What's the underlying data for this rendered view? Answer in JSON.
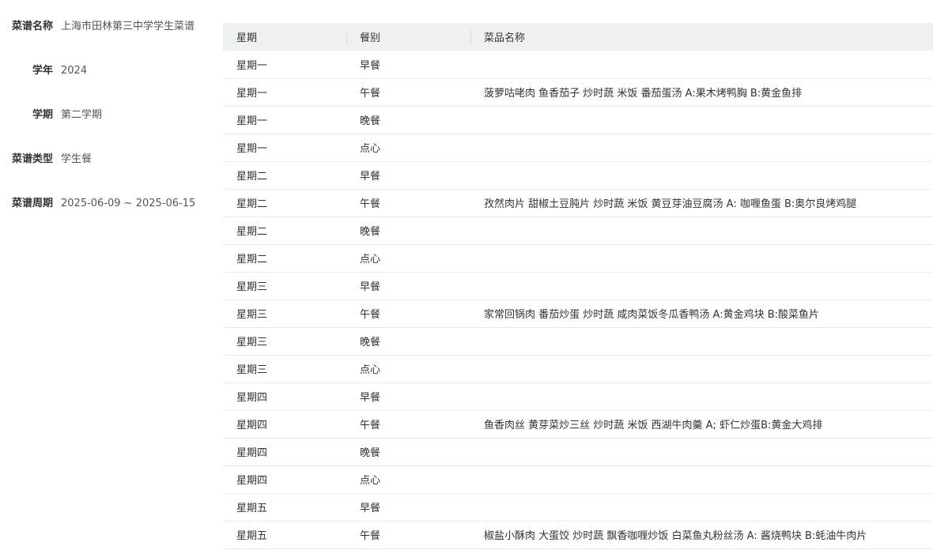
{
  "info": {
    "name_label": "菜谱名称",
    "name_value": "上海市田林第三中学学生菜谱",
    "year_label": "学年",
    "year_value": "2024",
    "term_label": "学期",
    "term_value": "第二学期",
    "type_label": "菜谱类型",
    "type_value": "学生餐",
    "period_label": "菜谱周期",
    "period_value": "2025-06-09 ~ 2025-06-15"
  },
  "table": {
    "headers": [
      "星期",
      "餐别",
      "菜品名称"
    ],
    "rows": [
      [
        "星期一",
        "早餐",
        ""
      ],
      [
        "星期一",
        "午餐",
        "菠萝咕咾肉 鱼香茄子 炒时蔬 米饭 番茄蛋汤 A:果木烤鸭胸 B:黄金鱼排"
      ],
      [
        "星期一",
        "晚餐",
        ""
      ],
      [
        "星期一",
        "点心",
        ""
      ],
      [
        "星期二",
        "早餐",
        ""
      ],
      [
        "星期二",
        "午餐",
        "孜然肉片 甜椒土豆肫片 炒时蔬 米饭 黄豆芽油豆腐汤 A: 咖喱鱼蛋 B:奥尔良烤鸡腿"
      ],
      [
        "星期二",
        "晚餐",
        ""
      ],
      [
        "星期二",
        "点心",
        ""
      ],
      [
        "星期三",
        "早餐",
        ""
      ],
      [
        "星期三",
        "午餐",
        "家常回锅肉 番茄炒蛋 炒时蔬 咸肉菜饭冬瓜香鸭汤 A:黄金鸡块 B:酸菜鱼片"
      ],
      [
        "星期三",
        "晚餐",
        ""
      ],
      [
        "星期三",
        "点心",
        ""
      ],
      [
        "星期四",
        "早餐",
        ""
      ],
      [
        "星期四",
        "午餐",
        "鱼香肉丝 黄芽菜炒三丝 炒时蔬 米饭 西湖牛肉羹 A; 虾仁炒蛋B:黄金大鸡排"
      ],
      [
        "星期四",
        "晚餐",
        ""
      ],
      [
        "星期四",
        "点心",
        ""
      ],
      [
        "星期五",
        "早餐",
        ""
      ],
      [
        "星期五",
        "午餐",
        "椒盐小酥肉 大蛋饺 炒时蔬 飘香咖喱炒饭 白菜鱼丸粉丝汤 A: 酱烧鸭块 B:蚝油牛肉片"
      ]
    ]
  }
}
